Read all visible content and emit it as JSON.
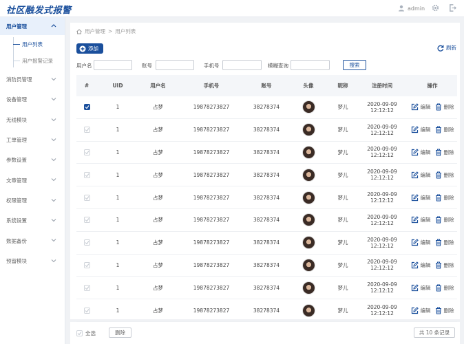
{
  "header": {
    "logo": "社区融发式报警",
    "username": "admin",
    "icons": [
      "user-icon",
      "gear-icon",
      "logout-icon"
    ]
  },
  "sidebar": {
    "active_item": "用户管理",
    "sub_items": [
      "用户列表",
      "用户报警记录"
    ],
    "active_sub": "用户列表",
    "items": [
      "消防员管理",
      "设备管理",
      "无线模块",
      "工单管理",
      "参数设置",
      "文章管理",
      "权限管理",
      "系统设置",
      "数据备份",
      "预留模块"
    ]
  },
  "breadcrumb": {
    "items": [
      "用户管理",
      "用户列表"
    ],
    "separator": ">"
  },
  "toolbar": {
    "add_label": "添加",
    "refresh_label": "刷新"
  },
  "filters": {
    "username_label": "用户名",
    "account_label": "账号",
    "phone_label": "手机号",
    "fuzzy_label": "模糊查询",
    "search_label": "搜索"
  },
  "table": {
    "headers": [
      "#",
      "UID",
      "用户名",
      "手机号",
      "账号",
      "头像",
      "昵称",
      "注册时间",
      "操作"
    ],
    "edit_label": "编辑",
    "delete_label": "删除",
    "rows": [
      {
        "checked": true,
        "uid": "1",
        "name": "占梦",
        "phone": "19878273827",
        "account": "38278374",
        "nickname": "梦儿",
        "time": "2020-09-09 12:12:12"
      },
      {
        "checked": false,
        "uid": "1",
        "name": "占梦",
        "phone": "19878273827",
        "account": "38278374",
        "nickname": "梦儿",
        "time": "2020-09-09 12:12:12"
      },
      {
        "checked": false,
        "uid": "1",
        "name": "占梦",
        "phone": "19878273827",
        "account": "38278374",
        "nickname": "梦儿",
        "time": "2020-09-09 12:12:12"
      },
      {
        "checked": false,
        "uid": "1",
        "name": "占梦",
        "phone": "19878273827",
        "account": "38278374",
        "nickname": "梦儿",
        "time": "2020-09-09 12:12:12"
      },
      {
        "checked": false,
        "uid": "1",
        "name": "占梦",
        "phone": "19878273827",
        "account": "38278374",
        "nickname": "梦儿",
        "time": "2020-09-09 12:12:12"
      },
      {
        "checked": false,
        "uid": "1",
        "name": "占梦",
        "phone": "19878273827",
        "account": "38278374",
        "nickname": "梦儿",
        "time": "2020-09-09 12:12:12"
      },
      {
        "checked": false,
        "uid": "1",
        "name": "占梦",
        "phone": "19878273827",
        "account": "38278374",
        "nickname": "梦儿",
        "time": "2020-09-09 12:12:12"
      },
      {
        "checked": false,
        "uid": "1",
        "name": "占梦",
        "phone": "19878273827",
        "account": "38278374",
        "nickname": "梦儿",
        "time": "2020-09-09 12:12:12"
      },
      {
        "checked": false,
        "uid": "1",
        "name": "占梦",
        "phone": "19878273827",
        "account": "38278374",
        "nickname": "梦儿",
        "time": "2020-09-09 12:12:12"
      },
      {
        "checked": false,
        "uid": "1",
        "name": "占梦",
        "phone": "19878273827",
        "account": "38278374",
        "nickname": "梦儿",
        "time": "2020-09-09 12:12:12"
      }
    ]
  },
  "footer": {
    "select_all_label": "全选",
    "delete_label": "删除",
    "count_label": "共 10 条记录"
  },
  "colors": {
    "primary": "#1a4f9c",
    "active_bg": "#e8f0fb",
    "page_bg": "#f0f2f5"
  }
}
